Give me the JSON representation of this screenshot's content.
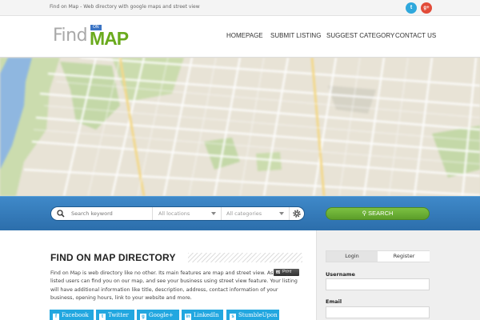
{
  "topbar": {
    "tagline": "Find on Map - Web directory with google maps and street view",
    "social": [
      {
        "name": "twitter-icon",
        "glyph": "t"
      },
      {
        "name": "google-plus-icon",
        "glyph": "g+"
      }
    ]
  },
  "header": {
    "logo": {
      "find": "Find",
      "on": "ON",
      "map": "MAP"
    },
    "nav": [
      "HOMEPAGE",
      "SUBMIT LISTING",
      "SUGGEST CATEGORY",
      "CONTACT US"
    ]
  },
  "search": {
    "keyword_placeholder": "Search keyword",
    "location_selected": "All locations",
    "category_selected": "All categories",
    "button_label": "SEARCH"
  },
  "content": {
    "title": "FIND ON MAP DIRECTORY",
    "print_label": "Print",
    "paragraph": "Find on Map is web directory like no other. Its main features are map and street view. As you get listed users can find you on our map, and see your business using street view feature. Your listing will have additional information like title, description, address, contact information of your business, opening hours, link to your website and more.",
    "share": [
      "Facebook",
      "Twitter",
      "Google+",
      "LinkedIn",
      "StumbleUpon"
    ]
  },
  "sidebar": {
    "tabs": [
      "Login",
      "Register"
    ],
    "username_label": "Username",
    "email_label": "Email"
  },
  "colors": {
    "brand_green": "#6aaa1d",
    "logo_on_blue": "#3b74c4",
    "search_bar_blue": "#2c6eab",
    "search_button_green": "#6bb035",
    "share_blue": "#22a7e0"
  }
}
